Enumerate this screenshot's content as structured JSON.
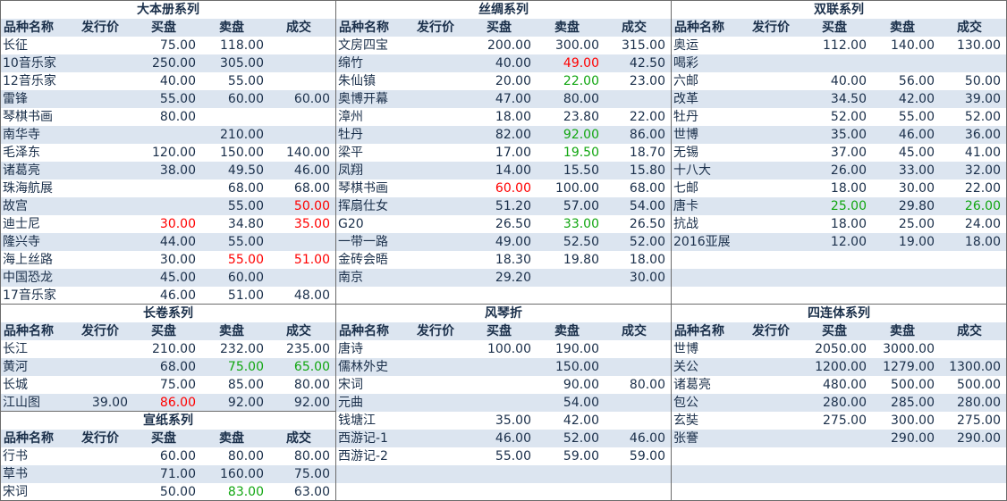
{
  "headers": [
    "品种名称",
    "发行价",
    "买盘",
    "卖盘",
    "成交"
  ],
  "colors": {
    "text": "#1a2f4a",
    "stripe": "#dce5f0",
    "up": "#ff0000",
    "down": "#11a611"
  },
  "panels": [
    {
      "title": "大本册系列",
      "rows": [
        {
          "name": "长征",
          "issue": "",
          "buy": "75.00",
          "sell": "118.00",
          "deal": ""
        },
        {
          "name": "10音乐家",
          "issue": "",
          "buy": "250.00",
          "sell": "305.00",
          "deal": ""
        },
        {
          "name": "12音乐家",
          "issue": "",
          "buy": "40.00",
          "sell": "55.00",
          "deal": ""
        },
        {
          "name": "雷锋",
          "issue": "",
          "buy": "55.00",
          "sell": "60.00",
          "deal": "60.00"
        },
        {
          "name": "琴棋书画",
          "issue": "",
          "buy": "80.00",
          "sell": "",
          "deal": ""
        },
        {
          "name": "南华寺",
          "issue": "",
          "buy": "",
          "sell": "210.00",
          "deal": ""
        },
        {
          "name": "毛泽东",
          "issue": "",
          "buy": "120.00",
          "sell": "150.00",
          "deal": "140.00"
        },
        {
          "name": "诸葛亮",
          "issue": "",
          "buy": "38.00",
          "sell": "49.50",
          "deal": "46.00"
        },
        {
          "name": "珠海航展",
          "issue": "",
          "buy": "",
          "sell": "68.00",
          "deal": "68.00"
        },
        {
          "name": "故宫",
          "issue": "",
          "buy": "",
          "sell": "55.00",
          "deal": "50.00",
          "deal_c": "red"
        },
        {
          "name": "迪士尼",
          "issue": "",
          "buy": "30.00",
          "buy_c": "red",
          "sell": "34.80",
          "deal": "35.00",
          "deal_c": "red"
        },
        {
          "name": "隆兴寺",
          "issue": "",
          "buy": "44.00",
          "sell": "55.00",
          "deal": ""
        },
        {
          "name": "海上丝路",
          "issue": "",
          "buy": "30.00",
          "sell": "55.00",
          "sell_c": "red",
          "deal": "51.00",
          "deal_c": "red"
        },
        {
          "name": "中国恐龙",
          "issue": "",
          "buy": "45.00",
          "sell": "60.00",
          "deal": ""
        },
        {
          "name": "17音乐家",
          "issue": "",
          "buy": "46.00",
          "sell": "51.00",
          "deal": "48.00"
        }
      ]
    },
    {
      "title": "丝绸系列",
      "rows": [
        {
          "name": "文房四宝",
          "issue": "",
          "buy": "200.00",
          "sell": "300.00",
          "deal": "315.00"
        },
        {
          "name": "绵竹",
          "issue": "",
          "buy": "40.00",
          "sell": "49.00",
          "sell_c": "red",
          "deal": "42.50"
        },
        {
          "name": "朱仙镇",
          "issue": "",
          "buy": "20.00",
          "sell": "22.00",
          "sell_c": "green",
          "deal": "23.00"
        },
        {
          "name": "奥博开幕",
          "issue": "",
          "buy": "47.00",
          "sell": "80.00",
          "deal": ""
        },
        {
          "name": "漳州",
          "issue": "",
          "buy": "18.00",
          "sell": "23.80",
          "deal": "22.00"
        },
        {
          "name": "牡丹",
          "issue": "",
          "buy": "82.00",
          "sell": "92.00",
          "sell_c": "green",
          "deal": "86.00"
        },
        {
          "name": "梁平",
          "issue": "",
          "buy": "17.00",
          "sell": "19.50",
          "sell_c": "green",
          "deal": "18.70"
        },
        {
          "name": "凤翔",
          "issue": "",
          "buy": "14.00",
          "sell": "15.50",
          "deal": "15.80"
        },
        {
          "name": "琴棋书画",
          "issue": "",
          "buy": "60.00",
          "buy_c": "red",
          "sell": "100.00",
          "deal": "68.00"
        },
        {
          "name": "挥扇仕女",
          "issue": "",
          "buy": "51.20",
          "sell": "57.00",
          "deal": "54.00"
        },
        {
          "name": "G20",
          "issue": "",
          "buy": "26.50",
          "sell": "33.00",
          "sell_c": "green",
          "deal": "26.50"
        },
        {
          "name": "一带一路",
          "issue": "",
          "buy": "49.00",
          "sell": "52.50",
          "deal": "52.00"
        },
        {
          "name": "金砖会晤",
          "issue": "",
          "buy": "18.30",
          "sell": "19.80",
          "deal": "18.00"
        },
        {
          "name": "南京",
          "issue": "",
          "buy": "29.20",
          "sell": "",
          "deal": "30.00"
        },
        {
          "name": "",
          "issue": "",
          "buy": "",
          "sell": "",
          "deal": ""
        }
      ]
    },
    {
      "title": "双联系列",
      "rows": [
        {
          "name": "奥运",
          "issue": "",
          "buy": "112.00",
          "sell": "140.00",
          "deal": "130.00"
        },
        {
          "name": "喝彩",
          "issue": "",
          "buy": "",
          "sell": "",
          "deal": ""
        },
        {
          "name": "六邮",
          "issue": "",
          "buy": "40.00",
          "sell": "56.00",
          "deal": "50.00"
        },
        {
          "name": "改革",
          "issue": "",
          "buy": "34.50",
          "sell": "42.00",
          "deal": "39.00"
        },
        {
          "name": "牡丹",
          "issue": "",
          "buy": "52.00",
          "sell": "55.00",
          "deal": "52.00"
        },
        {
          "name": "世博",
          "issue": "",
          "buy": "35.00",
          "sell": "46.00",
          "deal": "36.00"
        },
        {
          "name": "无锡",
          "issue": "",
          "buy": "37.00",
          "sell": "45.00",
          "deal": "41.00"
        },
        {
          "name": "十八大",
          "issue": "",
          "buy": "26.00",
          "sell": "33.00",
          "deal": "32.00"
        },
        {
          "name": "七邮",
          "issue": "",
          "buy": "18.00",
          "sell": "30.00",
          "deal": "22.00"
        },
        {
          "name": "唐卡",
          "issue": "",
          "buy": "25.00",
          "buy_c": "green",
          "sell": "29.80",
          "deal": "26.00",
          "deal_c": "green"
        },
        {
          "name": "抗战",
          "issue": "",
          "buy": "18.00",
          "sell": "25.00",
          "deal": "24.00"
        },
        {
          "name": "2016亚展",
          "issue": "",
          "buy": "12.00",
          "sell": "19.00",
          "deal": "18.00"
        },
        {
          "name": "",
          "issue": "",
          "buy": "",
          "sell": "",
          "deal": ""
        },
        {
          "name": "",
          "issue": "",
          "buy": "",
          "sell": "",
          "deal": ""
        },
        {
          "name": "",
          "issue": "",
          "buy": "",
          "sell": "",
          "deal": ""
        }
      ]
    },
    {
      "title": "长卷系列",
      "rows": [
        {
          "name": "长江",
          "issue": "",
          "buy": "210.00",
          "sell": "232.00",
          "deal": "235.00"
        },
        {
          "name": "黄河",
          "issue": "",
          "buy": "68.00",
          "sell": "75.00",
          "sell_c": "green",
          "deal": "65.00",
          "deal_c": "green"
        },
        {
          "name": "长城",
          "issue": "",
          "buy": "75.00",
          "sell": "85.00",
          "deal": "80.00"
        },
        {
          "name": "江山图",
          "issue": "39.00",
          "buy": "86.00",
          "buy_c": "red",
          "sell": "92.00",
          "deal": "92.00"
        }
      ]
    },
    {
      "title": "宣纸系列",
      "rows": [
        {
          "name": "行书",
          "issue": "",
          "buy": "60.00",
          "sell": "80.00",
          "deal": "80.00"
        },
        {
          "name": "草书",
          "issue": "",
          "buy": "71.00",
          "sell": "160.00",
          "deal": "75.00"
        },
        {
          "name": "宋词",
          "issue": "",
          "buy": "50.00",
          "sell": "83.00",
          "sell_c": "green",
          "deal": "63.00"
        }
      ]
    },
    {
      "title": "风琴折",
      "rows": [
        {
          "name": "唐诗",
          "issue": "",
          "buy": "100.00",
          "sell": "190.00",
          "deal": ""
        },
        {
          "name": "儒林外史",
          "issue": "",
          "buy": "",
          "sell": "150.00",
          "deal": ""
        },
        {
          "name": "宋词",
          "issue": "",
          "buy": "",
          "sell": "90.00",
          "deal": "80.00"
        },
        {
          "name": "元曲",
          "issue": "",
          "buy": "",
          "sell": "54.00",
          "deal": ""
        },
        {
          "name": "钱塘江",
          "issue": "",
          "buy": "35.00",
          "sell": "42.00",
          "deal": ""
        },
        {
          "name": "西游记-1",
          "issue": "",
          "buy": "46.00",
          "sell": "52.00",
          "deal": "46.00"
        },
        {
          "name": "西游记-2",
          "issue": "",
          "buy": "55.00",
          "sell": "59.00",
          "deal": "59.00"
        },
        {
          "name": "",
          "issue": "",
          "buy": "",
          "sell": "",
          "deal": ""
        },
        {
          "name": "",
          "issue": "",
          "buy": "",
          "sell": "",
          "deal": ""
        }
      ]
    },
    {
      "title": "四连体系列",
      "rows": [
        {
          "name": "世博",
          "issue": "",
          "buy": "2050.00",
          "sell": "3000.00",
          "deal": ""
        },
        {
          "name": "关公",
          "issue": "",
          "buy": "1200.00",
          "sell": "1279.00",
          "deal": "1300.00"
        },
        {
          "name": "诸葛亮",
          "issue": "",
          "buy": "480.00",
          "sell": "500.00",
          "deal": "500.00"
        },
        {
          "name": "包公",
          "issue": "",
          "buy": "280.00",
          "sell": "285.00",
          "deal": "280.00"
        },
        {
          "name": "玄奘",
          "issue": "",
          "buy": "275.00",
          "sell": "300.00",
          "deal": "275.00"
        },
        {
          "name": "张謇",
          "issue": "",
          "buy": "",
          "sell": "290.00",
          "deal": "290.00"
        },
        {
          "name": "",
          "issue": "",
          "buy": "",
          "sell": "",
          "deal": ""
        },
        {
          "name": "",
          "issue": "",
          "buy": "",
          "sell": "",
          "deal": ""
        },
        {
          "name": "",
          "issue": "",
          "buy": "",
          "sell": "",
          "deal": ""
        }
      ]
    }
  ]
}
